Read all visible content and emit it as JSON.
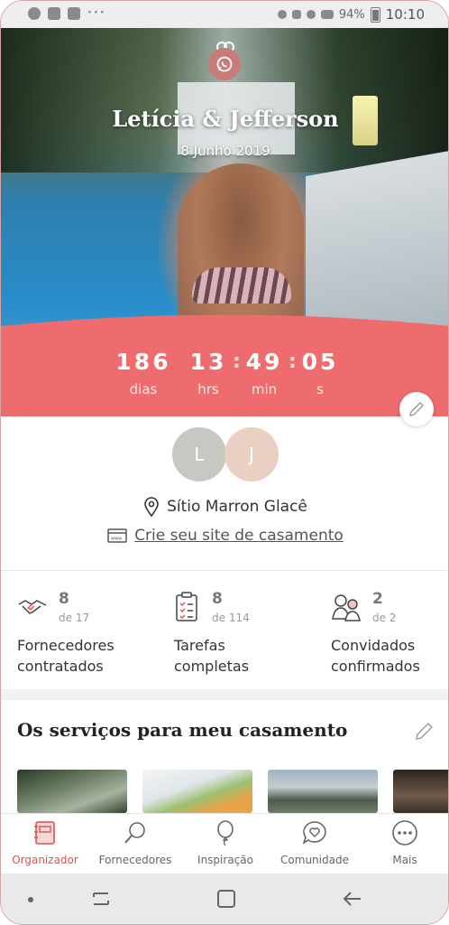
{
  "status_bar": {
    "battery": "94%",
    "time": "10:10",
    "more": "···"
  },
  "hero": {
    "couple_names": "Letícia & Jefferson",
    "date": "8 Junho 2019",
    "countdown": {
      "days": "186",
      "hours": "13",
      "minutes": "49",
      "seconds": "05",
      "days_label": "dias",
      "hours_label": "hrs",
      "minutes_label": "min",
      "seconds_label": "s",
      "separator": ":"
    }
  },
  "couple": {
    "initial_1": "L",
    "initial_2": "J",
    "venue": "Sítio Marron Glacê",
    "site_link": "Crie seu site de casamento"
  },
  "stats": [
    {
      "value": "8",
      "of": "de 17",
      "label_line1": "Fornecedores",
      "label_line2": "contratados",
      "icon": "handshake-icon"
    },
    {
      "value": "8",
      "of": "de 114",
      "label_line1": "Tarefas",
      "label_line2": "completas",
      "icon": "checklist-icon"
    },
    {
      "value": "2",
      "of": "de 2",
      "label_line1": "Convidados",
      "label_line2": "confirmados",
      "icon": "guests-icon"
    }
  ],
  "services": {
    "title": "Os serviços para meu casamento"
  },
  "bottom_nav": [
    {
      "label": "Organizador",
      "icon": "notebook-icon",
      "active": true
    },
    {
      "label": "Fornecedores",
      "icon": "search-icon",
      "active": false
    },
    {
      "label": "Inspiração",
      "icon": "balloon-icon",
      "active": false
    },
    {
      "label": "Comunidade",
      "icon": "chat-heart-icon",
      "active": false
    },
    {
      "label": "Mais",
      "icon": "more-icon",
      "active": false
    }
  ],
  "colors": {
    "accent": "#ee6b6e",
    "active_nav": "#d9534f",
    "brand_dark": "#c97b78"
  }
}
